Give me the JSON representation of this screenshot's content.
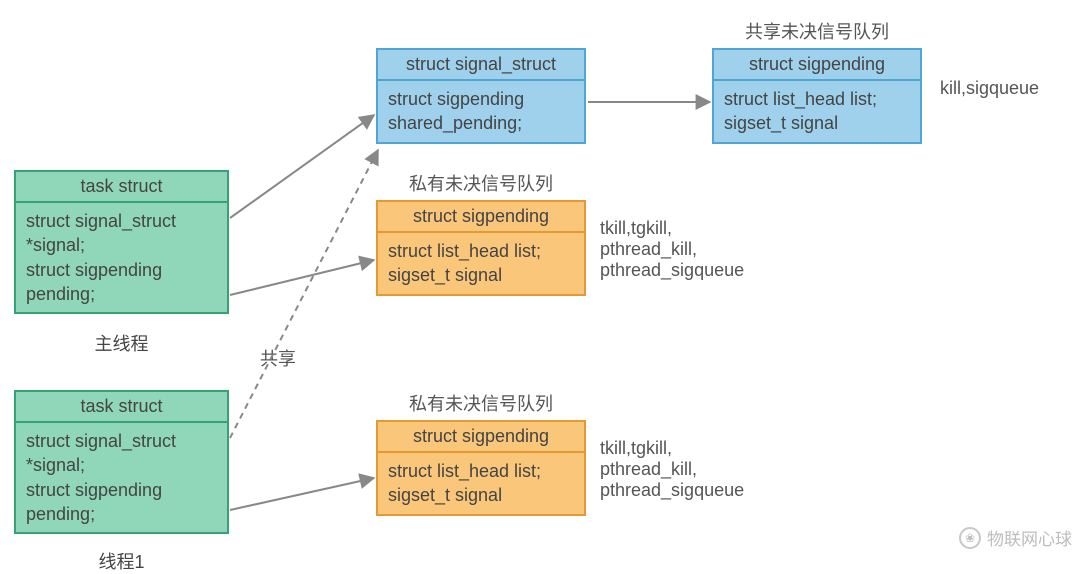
{
  "boxes": {
    "task_main": {
      "title": "task struct",
      "body": "struct signal_struct\n*signal;\nstruct sigpending\npending;"
    },
    "task_thread1": {
      "title": "task struct",
      "body": "struct signal_struct\n*signal;\nstruct sigpending\npending;"
    },
    "signal_struct": {
      "title": "struct signal_struct",
      "body": "struct sigpending\nshared_pending;"
    },
    "shared_sigpending": {
      "title": "struct sigpending",
      "body": "struct list_head list;\nsigset_t signal"
    },
    "private_sigpending_main": {
      "title": "struct sigpending",
      "body": "struct list_head list;\nsigset_t signal"
    },
    "private_sigpending_t1": {
      "title": "struct sigpending",
      "body": "struct list_head list;\nsigset_t signal"
    }
  },
  "labels": {
    "shared_queue_title": "共享未决信号队列",
    "private_queue_title_main": "私有未决信号队列",
    "private_queue_title_t1": "私有未决信号队列",
    "kill_funcs": "kill,sigqueue",
    "tkill_funcs_main": "tkill,tgkill,\npthread_kill,\npthread_sigqueue",
    "tkill_funcs_t1": "tkill,tgkill,\npthread_kill,\npthread_sigqueue",
    "share_label": "共享",
    "caption_main": "主线程",
    "caption_t1": "线程1",
    "watermark": "物联网心球"
  },
  "colors": {
    "green_fill": "#8fd7b8",
    "green_border": "#36a376",
    "blue_fill": "#9fd1ec",
    "blue_border": "#4fa6d2",
    "orange_fill": "#fac67a",
    "orange_border": "#e29b34",
    "arrow": "#888888"
  }
}
